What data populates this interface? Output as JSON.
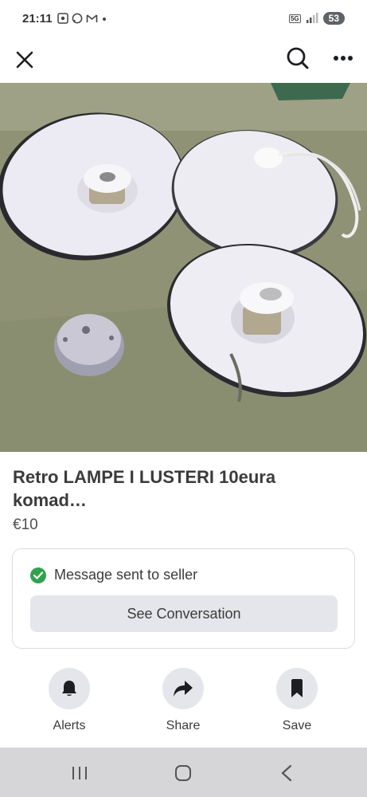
{
  "status_bar": {
    "time": "21:11",
    "network": "5G",
    "battery": "53"
  },
  "listing": {
    "title": "Retro LAMPE I LUSTERI 10eura komad…",
    "price": "€10",
    "photo_count": 9,
    "active_photo_index": 7
  },
  "message": {
    "status_text": "Message sent to seller",
    "button_label": "See Conversation"
  },
  "actions": {
    "alerts_label": "Alerts",
    "share_label": "Share",
    "save_label": "Save"
  },
  "icons": {
    "close": "close-icon",
    "search": "search-icon",
    "more": "more-icon",
    "alerts": "bell-icon",
    "share": "share-arrow-icon",
    "save": "bookmark-icon",
    "check": "check-circle-icon"
  },
  "colors": {
    "success": "#31a24c",
    "button_bg": "#e4e6eb",
    "nav_bg": "#d6d6d8"
  }
}
